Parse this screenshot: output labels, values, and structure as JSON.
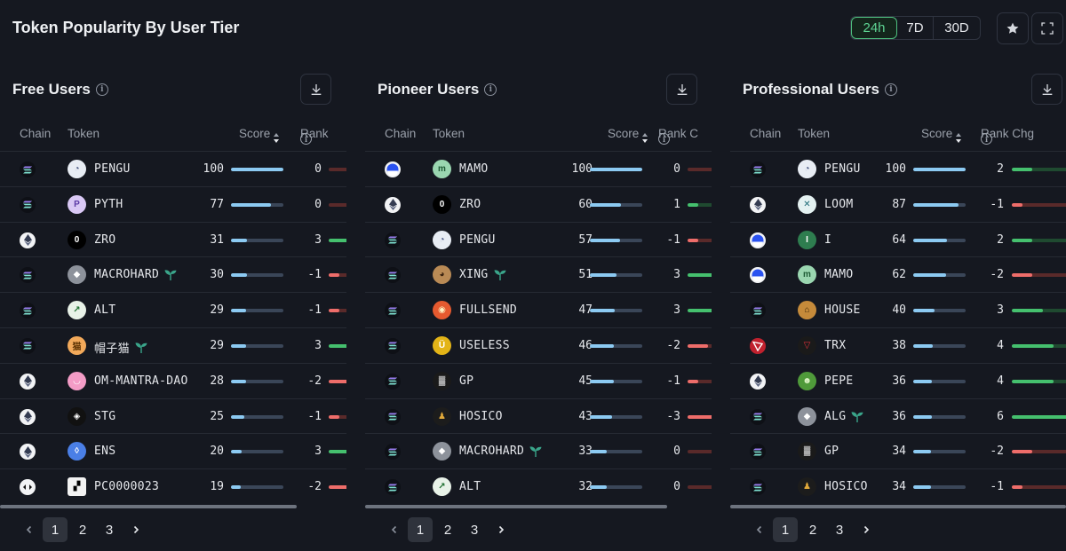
{
  "app": {
    "title": "Token Popularity By User Tier",
    "ranges": [
      "24h",
      "7D",
      "30D"
    ],
    "active_range": "24h"
  },
  "colors": {
    "accent": "#4ec07f",
    "score_bar": "#8ccaf2",
    "rank_up": "#45c06e",
    "rank_down": "#ee6d6a",
    "background": "#151820"
  },
  "columns": {
    "chain": "Chain",
    "token": "Token",
    "score": "Score"
  },
  "panels": [
    {
      "title": "Free Users",
      "rank_header": "Rank",
      "rows": [
        {
          "chain": "solana",
          "token": "PENGU",
          "icon": "pengu",
          "sprout": false,
          "score": 100,
          "rank_chg": 0
        },
        {
          "chain": "solana",
          "token": "PYTH",
          "icon": "pyth",
          "sprout": false,
          "score": 77,
          "rank_chg": 0
        },
        {
          "chain": "ethereum",
          "token": "ZRO",
          "icon": "zro",
          "sprout": false,
          "score": 31,
          "rank_chg": 3
        },
        {
          "chain": "solana",
          "token": "MACROHARD",
          "icon": "macrohard",
          "sprout": true,
          "score": 30,
          "rank_chg": -1
        },
        {
          "chain": "solana",
          "token": "ALT",
          "icon": "alt",
          "sprout": false,
          "score": 29,
          "rank_chg": -1
        },
        {
          "chain": "solana",
          "token": "帽子猫",
          "icon": "hatcat",
          "sprout": true,
          "score": 29,
          "rank_chg": 3
        },
        {
          "chain": "ethereum",
          "token": "OM-MANTRA-DAO",
          "icon": "om",
          "sprout": false,
          "score": 28,
          "rank_chg": -2
        },
        {
          "chain": "ethereum",
          "token": "STG",
          "icon": "stg",
          "sprout": false,
          "score": 25,
          "rank_chg": -1
        },
        {
          "chain": "ethereum",
          "token": "ENS",
          "icon": "ens",
          "sprout": false,
          "score": 20,
          "rank_chg": 3
        },
        {
          "chain": "bnb",
          "token": "PC0000023",
          "icon": "pc",
          "sprout": false,
          "score": 19,
          "rank_chg": -2
        }
      ],
      "pages": [
        "1",
        "2",
        "3"
      ],
      "current_page": "1"
    },
    {
      "title": "Pioneer Users",
      "rank_header": "Rank C",
      "rows": [
        {
          "chain": "base",
          "token": "MAMO",
          "icon": "mamo",
          "sprout": false,
          "score": 100,
          "rank_chg": 0
        },
        {
          "chain": "ethereum",
          "token": "ZRO",
          "icon": "zro",
          "sprout": false,
          "score": 60,
          "rank_chg": 1
        },
        {
          "chain": "solana",
          "token": "PENGU",
          "icon": "pengu",
          "sprout": false,
          "score": 57,
          "rank_chg": -1
        },
        {
          "chain": "solana",
          "token": "XING",
          "icon": "xing",
          "sprout": true,
          "score": 51,
          "rank_chg": 3
        },
        {
          "chain": "solana",
          "token": "FULLSEND",
          "icon": "fullsend",
          "sprout": false,
          "score": 47,
          "rank_chg": 3
        },
        {
          "chain": "solana",
          "token": "USELESS",
          "icon": "useless",
          "sprout": false,
          "score": 46,
          "rank_chg": -2
        },
        {
          "chain": "solana",
          "token": "GP",
          "icon": "gp",
          "sprout": false,
          "score": 45,
          "rank_chg": -1
        },
        {
          "chain": "solana",
          "token": "HOSICO",
          "icon": "hosico",
          "sprout": false,
          "score": 43,
          "rank_chg": -3
        },
        {
          "chain": "solana",
          "token": "MACROHARD",
          "icon": "macrohard",
          "sprout": true,
          "score": 33,
          "rank_chg": 0
        },
        {
          "chain": "solana",
          "token": "ALT",
          "icon": "alt",
          "sprout": false,
          "score": 32,
          "rank_chg": 0
        }
      ],
      "pages": [
        "1",
        "2",
        "3"
      ],
      "current_page": "1"
    },
    {
      "title": "Professional Users",
      "rank_header": "Rank Chg",
      "rows": [
        {
          "chain": "solana",
          "token": "PENGU",
          "icon": "pengu",
          "sprout": false,
          "score": 100,
          "rank_chg": 2
        },
        {
          "chain": "ethereum",
          "token": "LOOM",
          "icon": "loom",
          "sprout": false,
          "score": 87,
          "rank_chg": -1
        },
        {
          "chain": "base",
          "token": "I",
          "icon": "i",
          "sprout": false,
          "score": 64,
          "rank_chg": 2
        },
        {
          "chain": "base",
          "token": "MAMO",
          "icon": "mamo",
          "sprout": false,
          "score": 62,
          "rank_chg": -2
        },
        {
          "chain": "solana",
          "token": "HOUSE",
          "icon": "house",
          "sprout": false,
          "score": 40,
          "rank_chg": 3
        },
        {
          "chain": "tron",
          "token": "TRX",
          "icon": "trx",
          "sprout": false,
          "score": 38,
          "rank_chg": 4
        },
        {
          "chain": "ethereum",
          "token": "PEPE",
          "icon": "pepe",
          "sprout": false,
          "score": 36,
          "rank_chg": 4
        },
        {
          "chain": "solana",
          "token": "ALG",
          "icon": "alg",
          "sprout": true,
          "score": 36,
          "rank_chg": 6
        },
        {
          "chain": "solana",
          "token": "GP",
          "icon": "gp",
          "sprout": false,
          "score": 34,
          "rank_chg": -2
        },
        {
          "chain": "solana",
          "token": "HOSICO",
          "icon": "hosico",
          "sprout": false,
          "score": 34,
          "rank_chg": -1
        }
      ],
      "pages": [
        "1",
        "2",
        "3"
      ],
      "current_page": "1"
    }
  ]
}
